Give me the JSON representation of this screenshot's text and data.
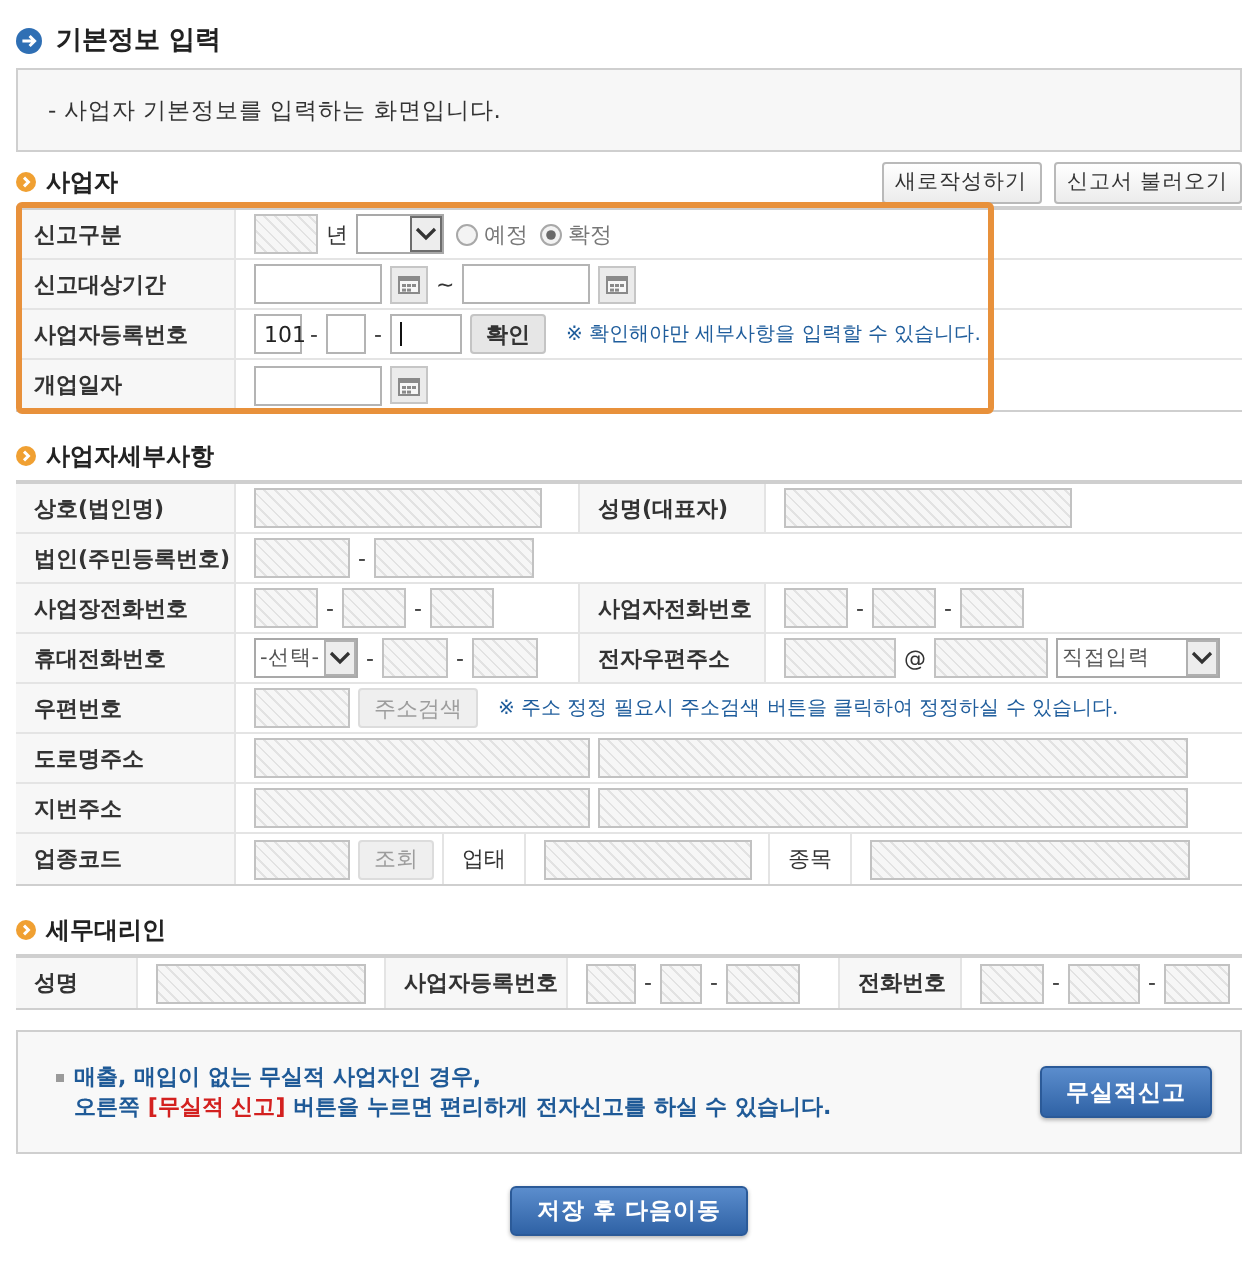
{
  "page_title": "기본정보 입력",
  "intro": "- 사업자 기본정보를 입력하는 화면입니다.",
  "sections": [
    {
      "title": "사업자",
      "highlighted": true,
      "buttons": [
        "새로작성하기",
        "신고서 불러오기"
      ],
      "rows": [
        {
          "cells": [
            {
              "kind": "label",
              "text": "신고구분"
            },
            {
              "kind": "content",
              "items": [
                {
                  "kind": "input",
                  "disabled": true
                },
                {
                  "kind": "unit",
                  "text": "년"
                },
                {
                  "kind": "select"
                },
                {
                  "kind": "radio",
                  "label": "예정",
                  "selected": false
                },
                {
                  "kind": "radio",
                  "label": "확정",
                  "selected": true
                }
              ]
            }
          ]
        },
        {
          "cells": [
            {
              "kind": "label",
              "text": "신고대상기간"
            },
            {
              "kind": "content",
              "items": [
                {
                  "kind": "input",
                  "disabled": false
                },
                {
                  "kind": "calendar"
                },
                {
                  "kind": "sep",
                  "text": "~"
                },
                {
                  "kind": "input",
                  "disabled": false
                },
                {
                  "kind": "calendar"
                }
              ]
            }
          ]
        },
        {
          "cells": [
            {
              "kind": "label",
              "text": "사업자등록번호"
            },
            {
              "kind": "content",
              "items": [
                {
                  "kind": "input",
                  "value": "101",
                  "disabled": false,
                  "focused": false
                },
                {
                  "kind": "sep",
                  "text": "-"
                },
                {
                  "kind": "input",
                  "disabled": false,
                  "focused": false
                },
                {
                  "kind": "sep",
                  "text": "-"
                },
                {
                  "kind": "input",
                  "disabled": false,
                  "focused": true
                },
                {
                  "kind": "button",
                  "label": "확인",
                  "disabled": false
                },
                {
                  "kind": "note",
                  "text": "※ 확인해야만 세부사항을 입력할 수 있습니다."
                }
              ]
            }
          ]
        },
        {
          "cells": [
            {
              "kind": "label",
              "text": "개업일자"
            },
            {
              "kind": "content",
              "items": [
                {
                  "kind": "input",
                  "disabled": false
                },
                {
                  "kind": "calendar"
                }
              ]
            }
          ]
        }
      ]
    },
    {
      "title": "사업자세부사항",
      "highlighted": false,
      "rows": [
        {
          "cells": [
            {
              "kind": "label",
              "text": "상호(법인명)"
            },
            {
              "kind": "content",
              "items": [
                {
                  "kind": "input",
                  "disabled": true
                }
              ]
            },
            {
              "kind": "label",
              "text": "성명(대표자)"
            },
            {
              "kind": "content",
              "items": [
                {
                  "kind": "input",
                  "disabled": true
                }
              ]
            }
          ]
        },
        {
          "cells": [
            {
              "kind": "label",
              "text": "법인(주민등록번호)"
            },
            {
              "kind": "content",
              "items": [
                {
                  "kind": "input",
                  "disabled": true
                },
                {
                  "kind": "sep",
                  "text": "-"
                },
                {
                  "kind": "input",
                  "disabled": true
                }
              ]
            }
          ]
        },
        {
          "cells": [
            {
              "kind": "label",
              "text": "사업장전화번호"
            },
            {
              "kind": "content",
              "items": [
                {
                  "kind": "input",
                  "disabled": true
                },
                {
                  "kind": "sep",
                  "text": "-"
                },
                {
                  "kind": "input",
                  "disabled": true
                },
                {
                  "kind": "sep",
                  "text": "-"
                },
                {
                  "kind": "input",
                  "disabled": true
                }
              ]
            },
            {
              "kind": "label",
              "text": "사업자전화번호"
            },
            {
              "kind": "content",
              "items": [
                {
                  "kind": "input",
                  "disabled": true
                },
                {
                  "kind": "sep",
                  "text": "-"
                },
                {
                  "kind": "input",
                  "disabled": true
                },
                {
                  "kind": "sep",
                  "text": "-"
                },
                {
                  "kind": "input",
                  "disabled": true
                }
              ]
            }
          ]
        },
        {
          "cells": [
            {
              "kind": "label",
              "text": "휴대전화번호"
            },
            {
              "kind": "content",
              "items": [
                {
                  "kind": "select",
                  "value": "-선택-"
                },
                {
                  "kind": "sep",
                  "text": "-"
                },
                {
                  "kind": "input",
                  "disabled": true
                },
                {
                  "kind": "sep",
                  "text": "-"
                },
                {
                  "kind": "input",
                  "disabled": true
                }
              ]
            },
            {
              "kind": "label",
              "text": "전자우편주소"
            },
            {
              "kind": "content",
              "items": [
                {
                  "kind": "input",
                  "disabled": true
                },
                {
                  "kind": "sep",
                  "text": "@"
                },
                {
                  "kind": "input",
                  "disabled": true
                },
                {
                  "kind": "select",
                  "value": "직접입력"
                }
              ]
            }
          ]
        },
        {
          "cells": [
            {
              "kind": "label",
              "text": "우편번호"
            },
            {
              "kind": "content",
              "items": [
                {
                  "kind": "input",
                  "disabled": true
                },
                {
                  "kind": "button",
                  "label": "주소검색",
                  "disabled": true
                },
                {
                  "kind": "note",
                  "text": "※ 주소 정정 필요시 주소검색 버튼을 클릭하여 정정하실 수 있습니다."
                }
              ]
            }
          ]
        },
        {
          "cells": [
            {
              "kind": "label",
              "text": "도로명주소"
            },
            {
              "kind": "content",
              "items": [
                {
                  "kind": "input",
                  "disabled": true
                },
                {
                  "kind": "input",
                  "disabled": true
                }
              ]
            }
          ]
        },
        {
          "cells": [
            {
              "kind": "label",
              "text": "지번주소"
            },
            {
              "kind": "content",
              "items": [
                {
                  "kind": "input",
                  "disabled": true
                },
                {
                  "kind": "input",
                  "disabled": true
                }
              ]
            }
          ]
        },
        {
          "cells": [
            {
              "kind": "label",
              "text": "업종코드"
            },
            {
              "kind": "content",
              "items": [
                {
                  "kind": "input",
                  "disabled": true
                },
                {
                  "kind": "button",
                  "label": "조회",
                  "disabled": true
                }
              ]
            },
            {
              "kind": "sublabel",
              "text": "업태"
            },
            {
              "kind": "content",
              "items": [
                {
                  "kind": "input",
                  "disabled": true
                }
              ]
            },
            {
              "kind": "sublabel",
              "text": "종목"
            },
            {
              "kind": "content",
              "items": [
                {
                  "kind": "input",
                  "disabled": true
                }
              ]
            }
          ]
        }
      ]
    },
    {
      "title": "세무대리인",
      "highlighted": false,
      "rows": [
        {
          "cells": [
            {
              "kind": "label",
              "text": "성명"
            },
            {
              "kind": "content",
              "items": [
                {
                  "kind": "input",
                  "disabled": true
                }
              ]
            },
            {
              "kind": "label",
              "text": "사업자등록번호"
            },
            {
              "kind": "content",
              "items": [
                {
                  "kind": "input",
                  "disabled": true
                },
                {
                  "kind": "sep",
                  "text": "-"
                },
                {
                  "kind": "input",
                  "disabled": true
                },
                {
                  "kind": "sep",
                  "text": "-"
                },
                {
                  "kind": "input",
                  "disabled": true
                }
              ]
            },
            {
              "kind": "label",
              "text": "전화번호"
            },
            {
              "kind": "content",
              "items": [
                {
                  "kind": "input",
                  "disabled": true
                },
                {
                  "kind": "sep",
                  "text": "-"
                },
                {
                  "kind": "input",
                  "disabled": true
                },
                {
                  "kind": "sep",
                  "text": "-"
                },
                {
                  "kind": "input",
                  "disabled": true
                }
              ]
            }
          ]
        }
      ]
    }
  ],
  "notice": {
    "lines": [
      "매출, 매입이 없는 무실적 사업자인 경우,",
      "오른쪽 **[무실적 신고]** 버튼을 누르면 편리하게 전자신고를 하실 수 있습니다."
    ],
    "button": "무실적신고"
  },
  "save_button": "저장 후 다음이동"
}
